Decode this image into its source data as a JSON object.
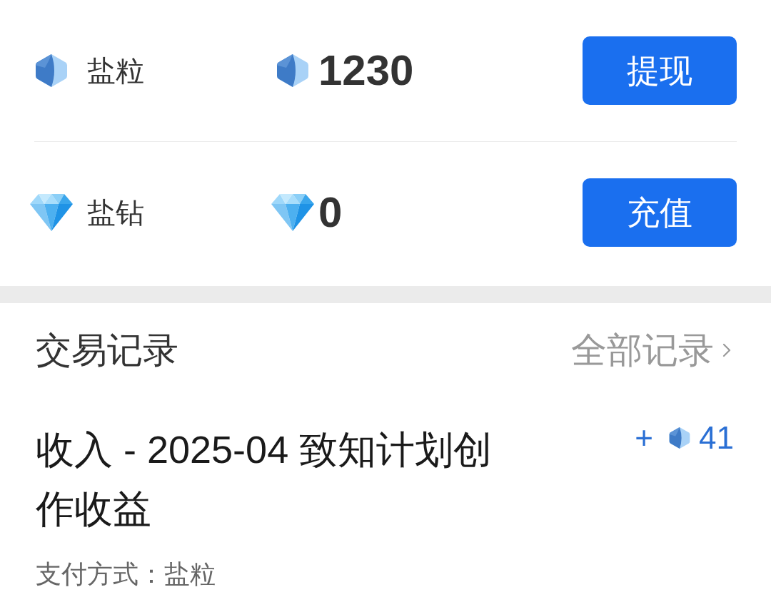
{
  "balances": [
    {
      "kind": "hex",
      "label": "盐粒",
      "amount": "1230",
      "button": "提现"
    },
    {
      "kind": "diamond",
      "label": "盐钻",
      "amount": "0",
      "button": "充值"
    }
  ],
  "records_header": {
    "title": "交易记录",
    "link": "全部记录"
  },
  "transactions": [
    {
      "title": "收入 - 2025-04 致知计划创作收益",
      "credit": {
        "sign": "+",
        "kind": "hex",
        "value": "41"
      },
      "payment": "支付方式：盐粒"
    }
  ]
}
